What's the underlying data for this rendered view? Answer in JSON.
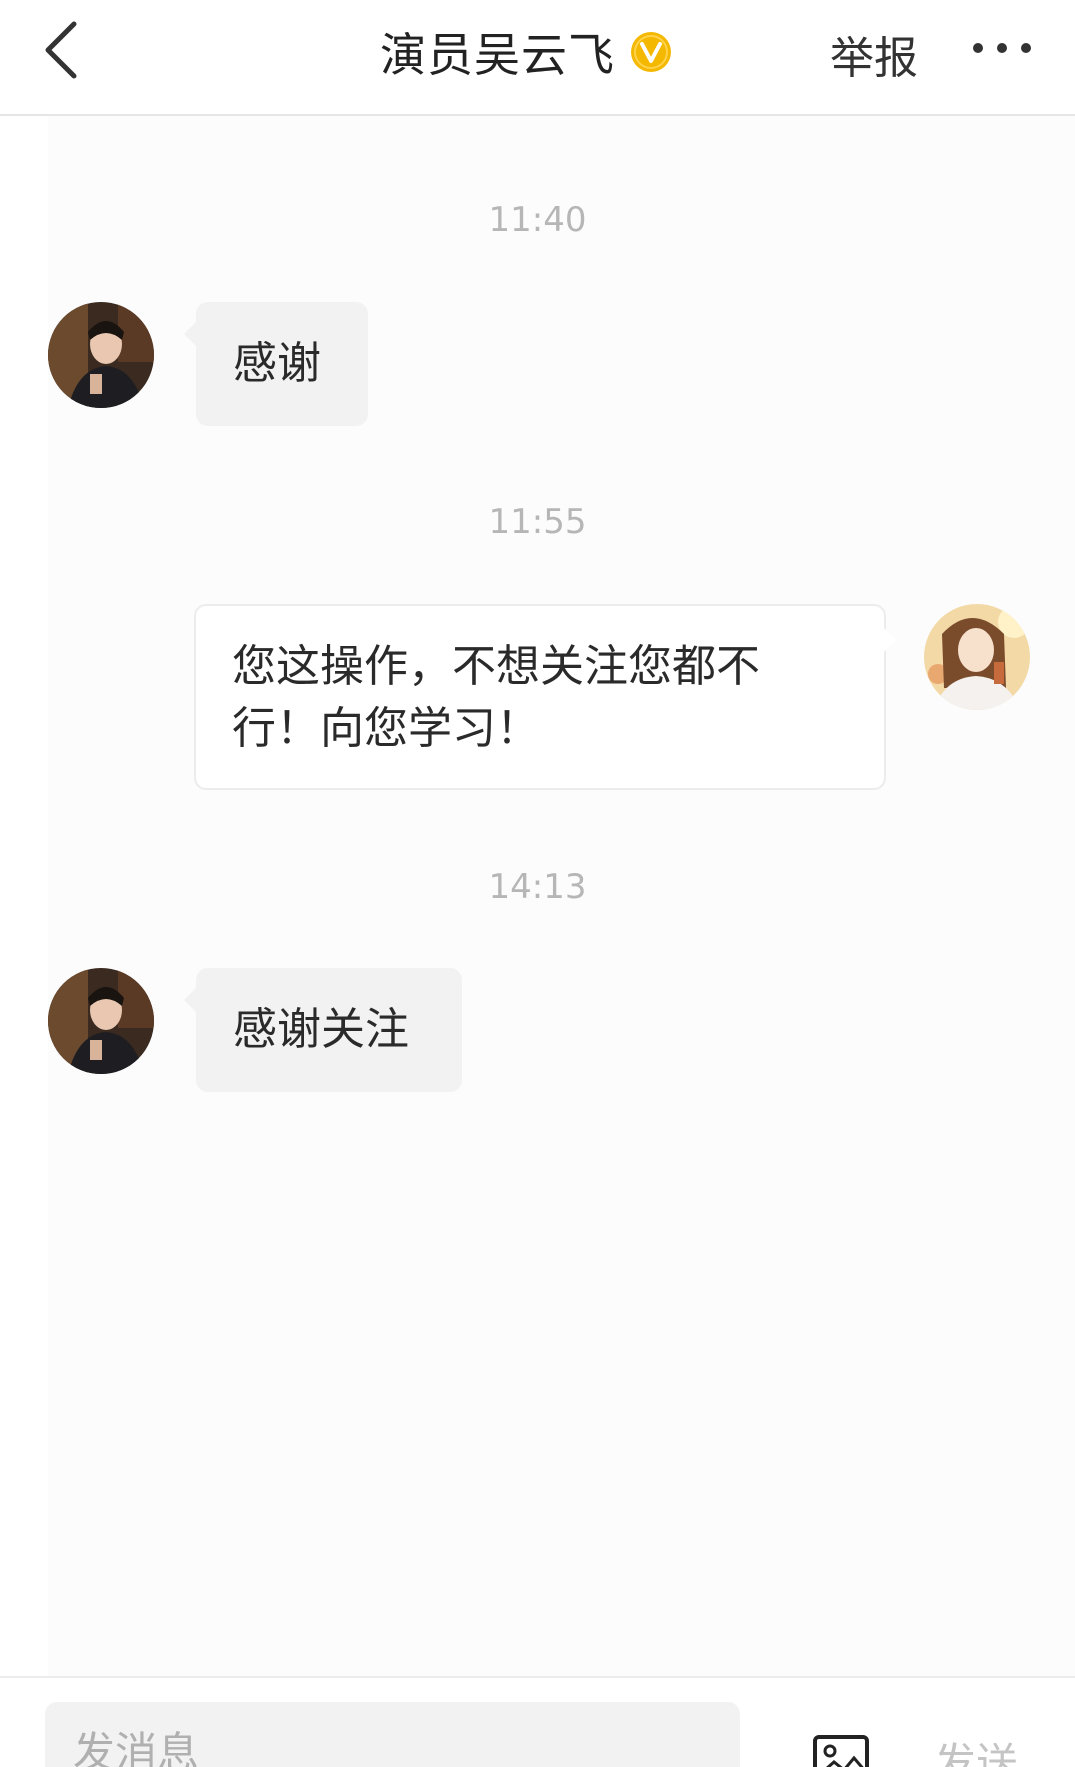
{
  "header": {
    "title": "演员吴云飞",
    "report_label": "举报"
  },
  "messages": [
    {
      "timestamp": "11:40",
      "direction": "incoming",
      "text": "感谢"
    },
    {
      "timestamp": "11:55",
      "direction": "outgoing",
      "text_line1": "您这操作，不想关注您都不",
      "text_line2": "行！向您学习！"
    },
    {
      "timestamp": "14:13",
      "direction": "incoming",
      "text": "感谢关注"
    }
  ],
  "input_bar": {
    "placeholder": "发消息",
    "send_label": "发送"
  },
  "colors": {
    "verified_badge": "#f5b800",
    "timestamp_text": "#b6b6b6",
    "incoming_bubble": "#f2f2f3",
    "outgoing_bubble": "#ffffff"
  }
}
